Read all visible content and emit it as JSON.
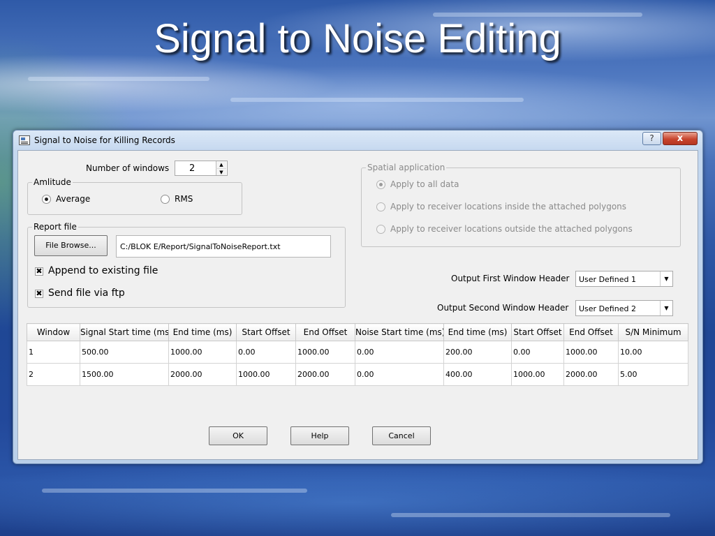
{
  "slide": {
    "title": "Signal to Noise Editing"
  },
  "dialog": {
    "title": "Signal to Noise for Killing Records",
    "help_glyph": "?",
    "close_glyph": "x",
    "number_of_windows": {
      "label": "Number of windows",
      "value": "2"
    },
    "amplitude": {
      "group_title": "Amlitude",
      "options": [
        {
          "label": "Average",
          "selected": true
        },
        {
          "label": "RMS",
          "selected": false
        }
      ]
    },
    "report_file": {
      "group_title": "Report file",
      "browse_label": "File Browse...",
      "path": "C:/BLOK E/Report/SignalToNoiseReport.txt",
      "append_label": "Append to existing file",
      "append_checked": true,
      "ftp_label": "Send file via ftp",
      "ftp_checked": true,
      "check_glyph": "✖"
    },
    "spatial": {
      "group_title": "Spatial application",
      "options": [
        {
          "label": "Apply to all data",
          "selected": true
        },
        {
          "label": "Apply to receiver locations inside the attached polygons",
          "selected": false
        },
        {
          "label": "Apply to receiver locations outside the attached polygons",
          "selected": false
        }
      ]
    },
    "output_first": {
      "label": "Output First Window Header",
      "value": "User Defined 1"
    },
    "output_second": {
      "label": "Output Second Window Header",
      "value": "User Defined 2"
    },
    "table": {
      "columns": [
        "Window",
        "Signal Start time (ms)",
        "End time (ms)",
        "Start Offset",
        "End Offset",
        "Noise Start time (ms)",
        "End time (ms)",
        "Start Offset",
        "End Offset",
        "S/N Minimum"
      ],
      "rows": [
        [
          "1",
          "500.00",
          "1000.00",
          "0.00",
          "1000.00",
          "0.00",
          "200.00",
          "0.00",
          "1000.00",
          "10.00"
        ],
        [
          "2",
          "1500.00",
          "2000.00",
          "1000.00",
          "2000.00",
          "0.00",
          "400.00",
          "1000.00",
          "2000.00",
          "5.00"
        ]
      ]
    },
    "buttons": {
      "ok": "OK",
      "help": "Help",
      "cancel": "Cancel"
    }
  },
  "icons": {
    "app": "app-window-icon",
    "help": "question-mark-icon",
    "close": "close-x-icon",
    "spin_up": "triangle-up-icon",
    "spin_down": "triangle-down-icon",
    "combo_arrow": "chevron-down-icon",
    "checkbox": "x-check-icon"
  },
  "colors": {
    "title_text": "#ffffff",
    "close_button": "#c8452e",
    "window_frame": "#b9cfe9",
    "client_bg": "#f0f0f0"
  }
}
